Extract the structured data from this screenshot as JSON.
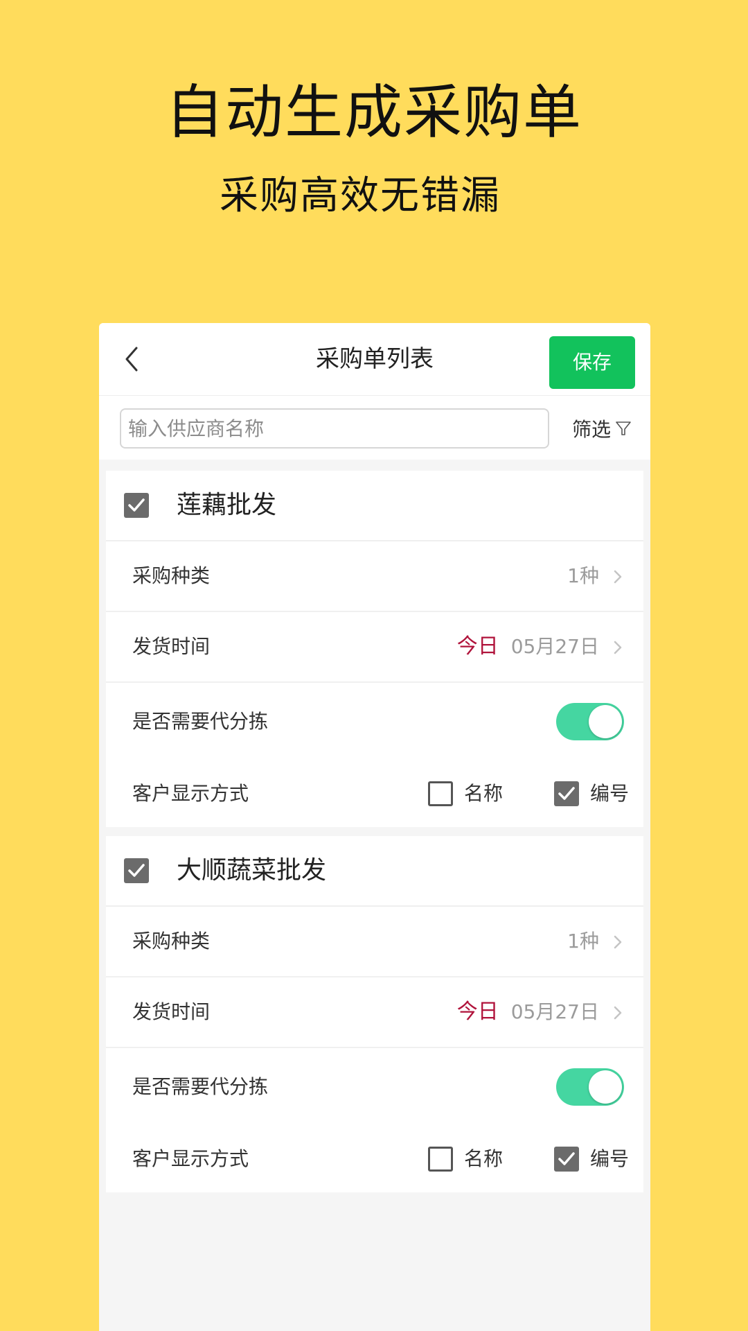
{
  "promo": {
    "title": "自动生成采购单",
    "subtitle": "采购高效无错漏"
  },
  "nav": {
    "title": "采购单列表",
    "save_label": "保存",
    "back_icon": "chevron-left-icon"
  },
  "search": {
    "placeholder": "输入供应商名称",
    "value": "",
    "filter_label": "筛选",
    "filter_icon": "funnel-icon"
  },
  "suppliers": [
    {
      "name": "莲藕批发",
      "checked": true,
      "purchase_type_label": "采购种类",
      "purchase_type_value": "1种",
      "ship_time_label": "发货时间",
      "ship_time_today": "今日",
      "ship_time_date": "05月27日",
      "sorting_label": "是否需要代分拣",
      "sorting_enabled": true,
      "display_label": "客户显示方式",
      "display_options": [
        {
          "label": "名称",
          "checked": false
        },
        {
          "label": "编号",
          "checked": true
        }
      ]
    },
    {
      "name": "大顺蔬菜批发",
      "checked": true,
      "purchase_type_label": "采购种类",
      "purchase_type_value": "1种",
      "ship_time_label": "发货时间",
      "ship_time_today": "今日",
      "ship_time_date": "05月27日",
      "sorting_label": "是否需要代分拣",
      "sorting_enabled": true,
      "display_label": "客户显示方式",
      "display_options": [
        {
          "label": "名称",
          "checked": false
        },
        {
          "label": "编号",
          "checked": true
        }
      ]
    }
  ],
  "colors": {
    "background": "#ffdc5c",
    "save_button": "#12c25c",
    "toggle_on": "#45d6a1",
    "today_text": "#b0133b",
    "checkbox_checked": "#6b6b6b"
  }
}
